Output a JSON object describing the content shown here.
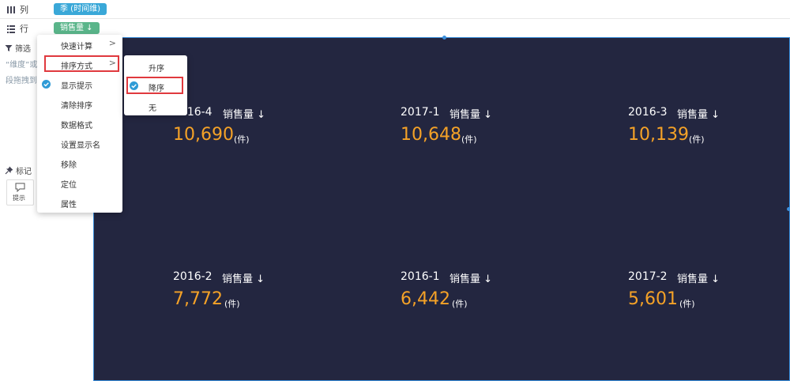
{
  "shelves": {
    "columns": {
      "label": "列",
      "icon": "columns-icon",
      "pill": "季 (时间维)"
    },
    "rows": {
      "label": "行",
      "icon": "rows-icon",
      "pill": "销售量 ↓"
    }
  },
  "left_panel": {
    "filter_title": "筛选",
    "filter_hint_1": "“维度”或",
    "filter_hint_2": "段拖拽到此",
    "marks_title": "标记",
    "tip_label": "提示"
  },
  "context_menu": {
    "items": [
      {
        "label": "快速计算",
        "submenu": true,
        "checked": false
      },
      {
        "label": "排序方式",
        "submenu": true,
        "checked": false,
        "highlighted": true
      },
      {
        "label": "显示提示",
        "submenu": false,
        "checked": true
      },
      {
        "label": "清除排序",
        "submenu": false,
        "checked": false
      },
      {
        "label": "数据格式",
        "submenu": false,
        "checked": false
      },
      {
        "label": "设置显示名",
        "submenu": false,
        "checked": false
      },
      {
        "label": "移除",
        "submenu": false,
        "checked": false
      },
      {
        "label": "定位",
        "submenu": false,
        "checked": false
      },
      {
        "label": "属性",
        "submenu": false,
        "checked": false
      }
    ],
    "chevron": ">"
  },
  "sort_submenu": {
    "items": [
      {
        "label": "升序",
        "checked": false
      },
      {
        "label": "降序",
        "checked": true,
        "highlighted": true
      },
      {
        "label": "无",
        "checked": false
      }
    ]
  },
  "cards": [
    {
      "period": "2016-4",
      "measure": "销售量 ↓",
      "value": "10,690",
      "unit": "(件)"
    },
    {
      "period": "2017-1",
      "measure": "销售量 ↓",
      "value": "10,648",
      "unit": "(件)"
    },
    {
      "period": "2016-3",
      "measure": "销售量 ↓",
      "value": "10,139",
      "unit": "(件)"
    },
    {
      "period": "2016-2",
      "measure": "销售量 ↓",
      "value": "7,772",
      "unit": "(件)"
    },
    {
      "period": "2016-1",
      "measure": "销售量 ↓",
      "value": "6,442",
      "unit": "(件)"
    },
    {
      "period": "2017-2",
      "measure": "销售量 ↓",
      "value": "5,601",
      "unit": "(件)"
    }
  ],
  "colors": {
    "canvas_bg": "#232640",
    "value": "#f5a227",
    "pill_columns": "#3aa8d8",
    "pill_rows": "#5ab58a",
    "highlight_border": "#e0393e",
    "check": "#2f9bd6"
  }
}
